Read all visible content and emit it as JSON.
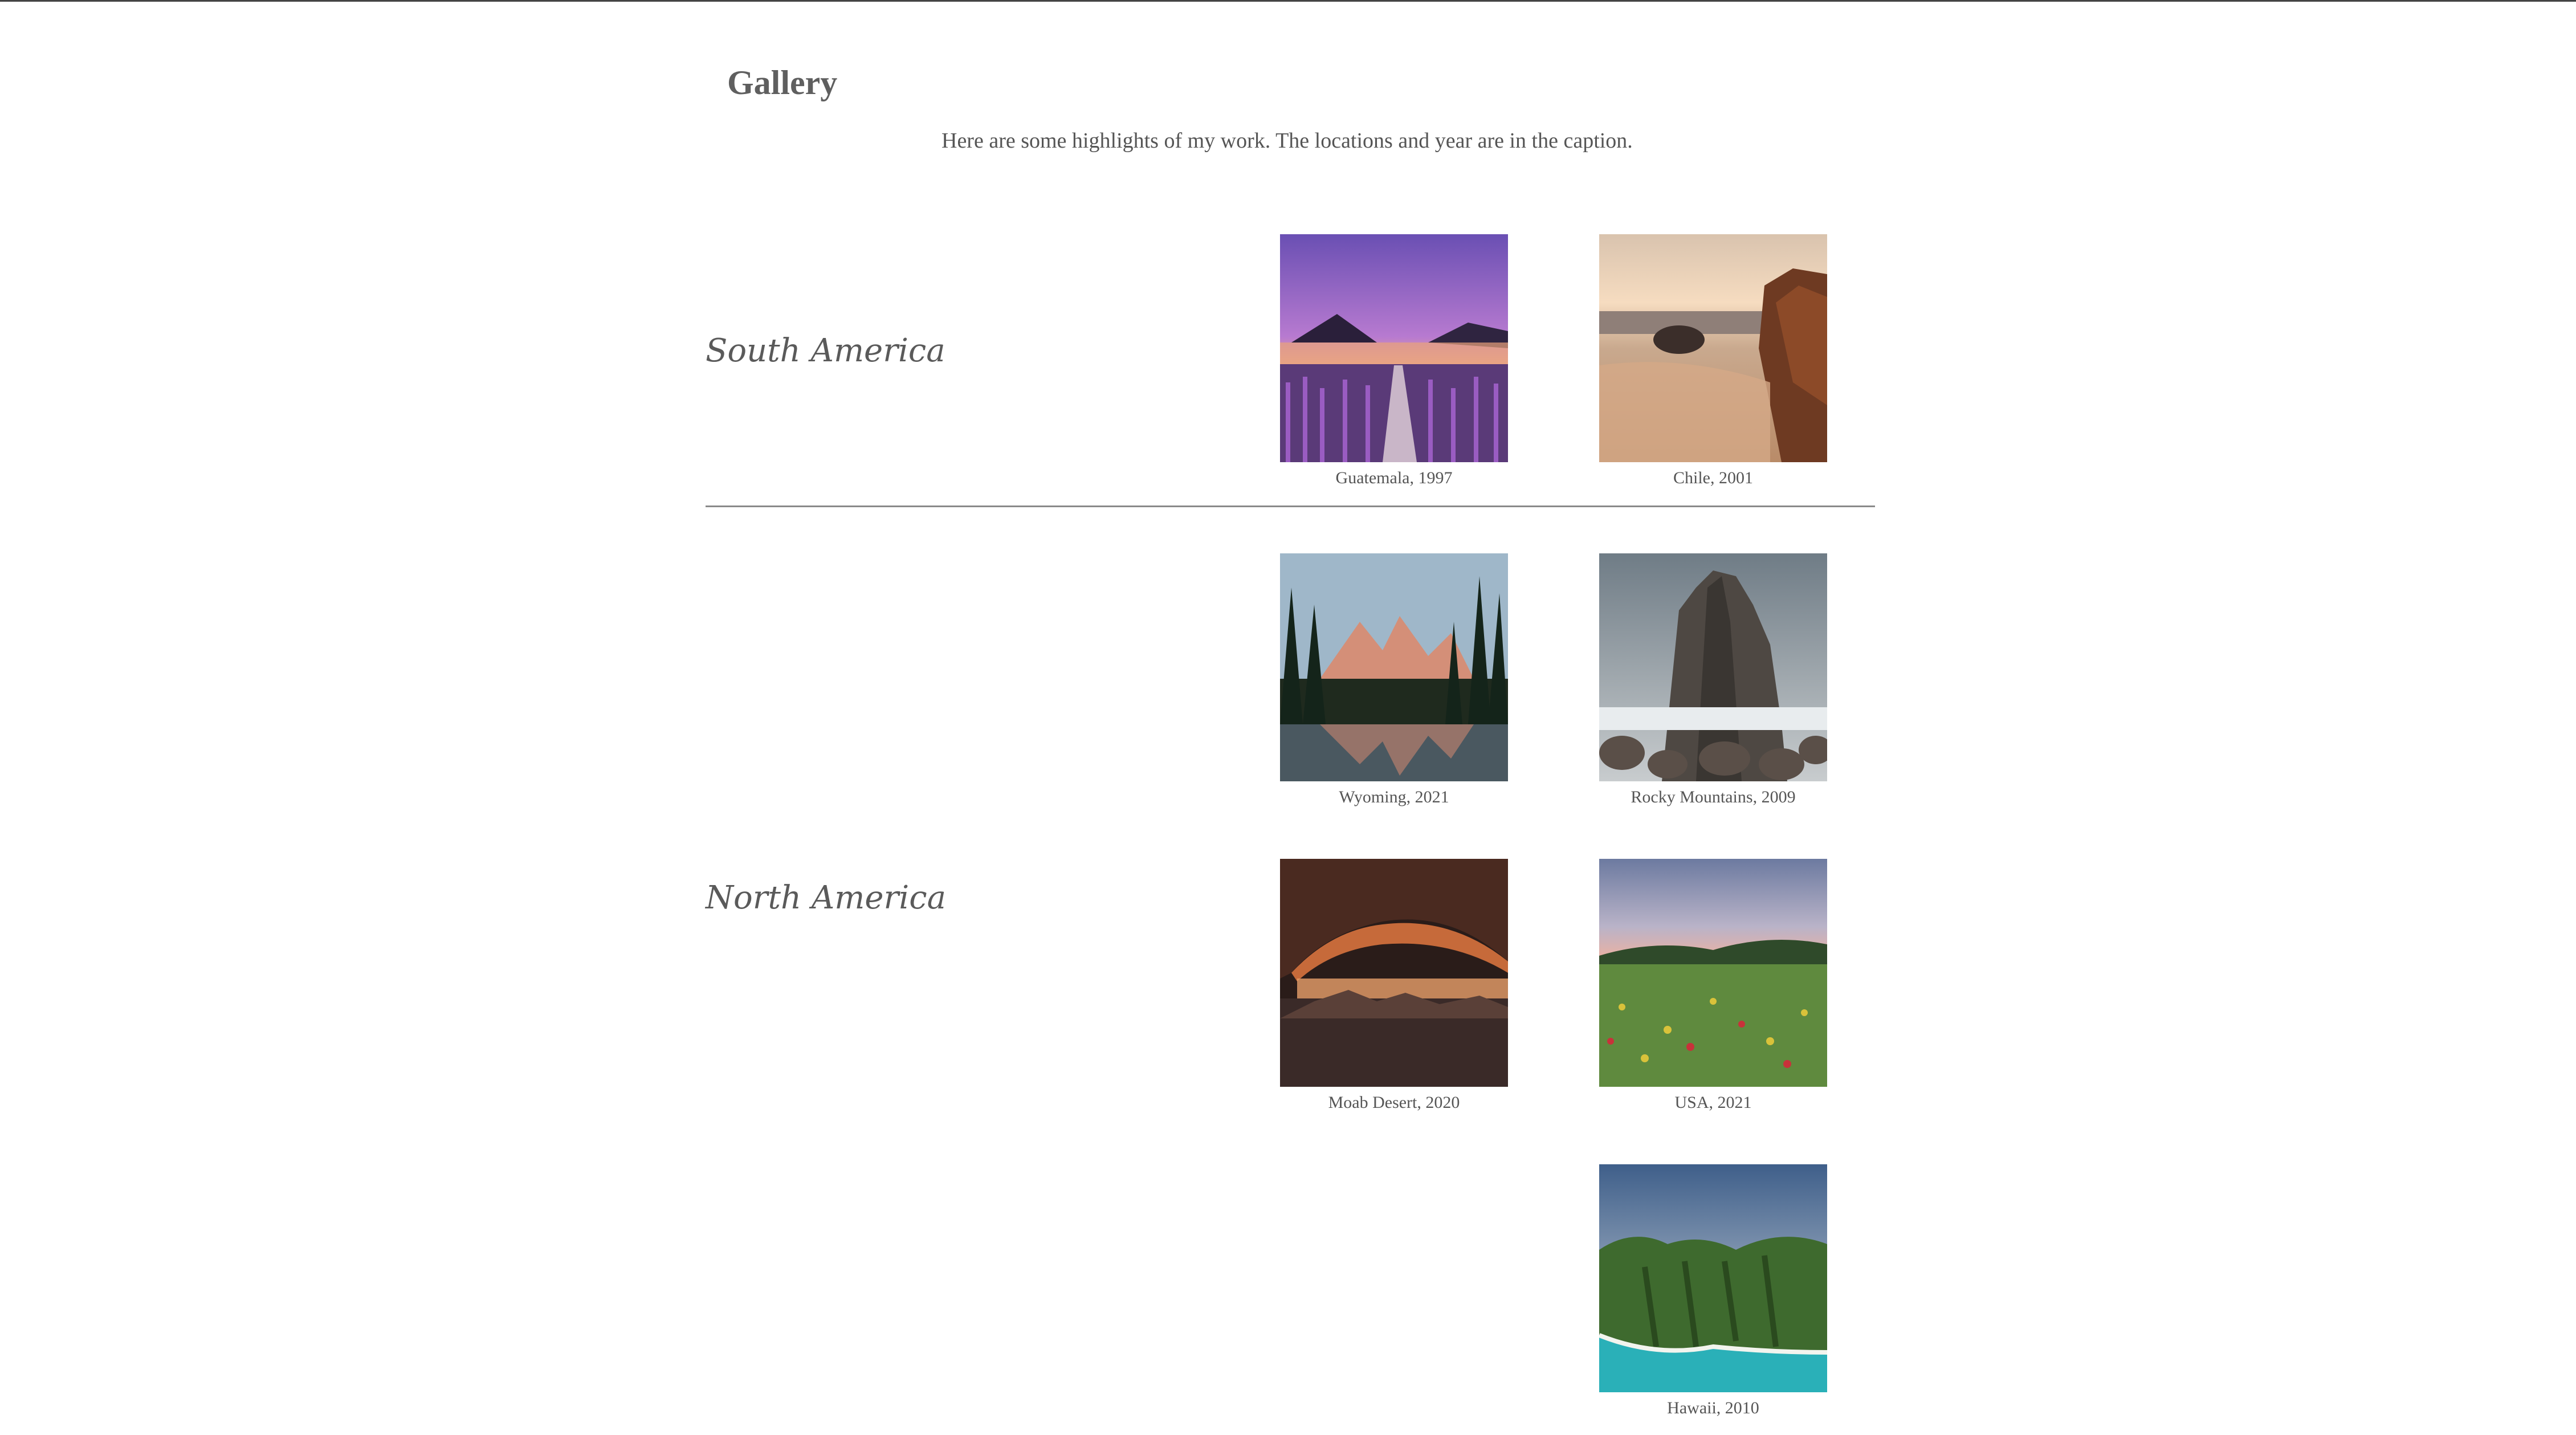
{
  "header": {
    "title": "Gallery",
    "intro": "Here are some highlights of my work. The locations and year are in the caption."
  },
  "sections": [
    {
      "label": "South America",
      "photos": [
        {
          "caption": "Guatemala, 1997",
          "icon": "lavender-lake-photo"
        },
        {
          "caption": "Chile, 2001",
          "icon": "coastal-rocks-photo"
        }
      ]
    },
    {
      "label": "North America",
      "photos": [
        {
          "caption": "Wyoming, 2021",
          "icon": "mountain-lake-photo"
        },
        {
          "caption": "Rocky Mountains, 2009",
          "icon": "rock-spires-photo"
        },
        {
          "caption": "Moab Desert, 2020",
          "icon": "desert-arch-photo"
        },
        {
          "caption": "USA, 2021",
          "icon": "wildflower-meadow-photo"
        },
        {
          "caption": "Hawaii, 2010",
          "icon": "coastal-cliffs-photo"
        }
      ]
    }
  ],
  "colors": {
    "text": "#555555",
    "divider": "#8a8a8a",
    "background": "#ffffff"
  }
}
